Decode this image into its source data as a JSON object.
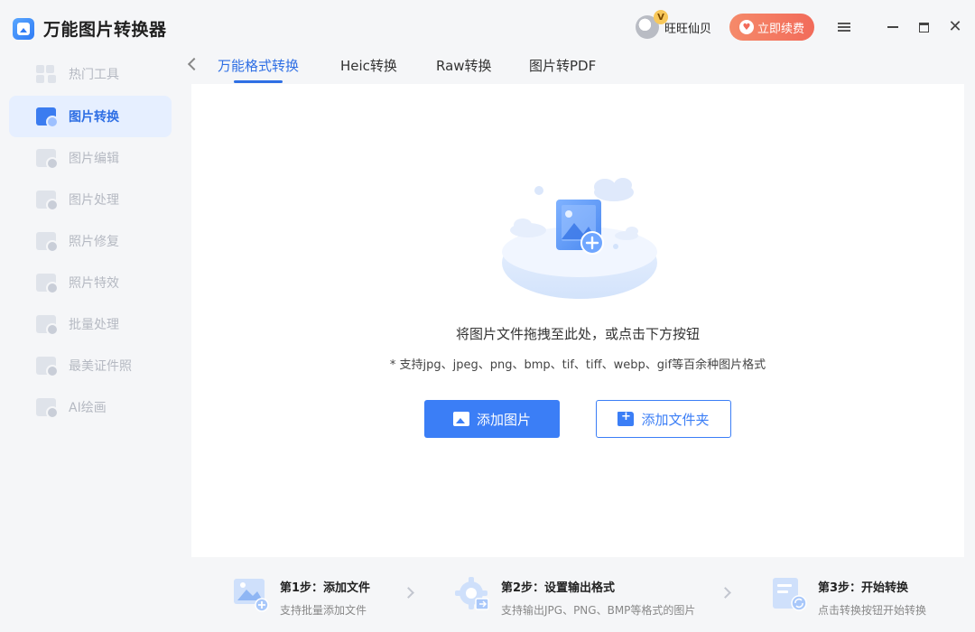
{
  "app": {
    "title": "万能图片转换器"
  },
  "sidebar": {
    "items": [
      {
        "label": "热门工具",
        "active": false
      },
      {
        "label": "图片转换",
        "active": true
      },
      {
        "label": "图片编辑",
        "active": false
      },
      {
        "label": "图片处理",
        "active": false
      },
      {
        "label": "照片修复",
        "active": false
      },
      {
        "label": "照片特效",
        "active": false
      },
      {
        "label": "批量处理",
        "active": false
      },
      {
        "label": "最美证件照",
        "active": false
      },
      {
        "label": "AI绘画",
        "active": false
      }
    ]
  },
  "titlebar": {
    "vip_badge": "V",
    "user_name": "旺旺仙贝",
    "renew_label": "立即续费"
  },
  "tabs": [
    {
      "label": "万能格式转换",
      "active": true
    },
    {
      "label": "Heic转换",
      "active": false
    },
    {
      "label": "Raw转换",
      "active": false
    },
    {
      "label": "图片转PDF",
      "active": false
    }
  ],
  "main": {
    "drop_hint": "将图片文件拖拽至此处，或点击下方按钮",
    "formats_hint": "* 支持jpg、jpeg、png、bmp、tif、tiff、webp、gif等百余种图片格式",
    "add_image_label": "添加图片",
    "add_folder_label": "添加文件夹"
  },
  "steps": [
    {
      "title": "第1步：添加文件",
      "desc": "支持批量添加文件"
    },
    {
      "title": "第2步：设置输出格式",
      "desc": "支持输出JPG、PNG、BMP等格式的图片"
    },
    {
      "title": "第3步：开始转换",
      "desc": "点击转换按钮开始转换"
    }
  ],
  "colors": {
    "accent": "#3b7ef6",
    "active_nav_bg": "#e6efff",
    "renew_gradient_start": "#f58a6a",
    "renew_gradient_end": "#f26b5a",
    "vip_badge": "#f8c85a"
  }
}
